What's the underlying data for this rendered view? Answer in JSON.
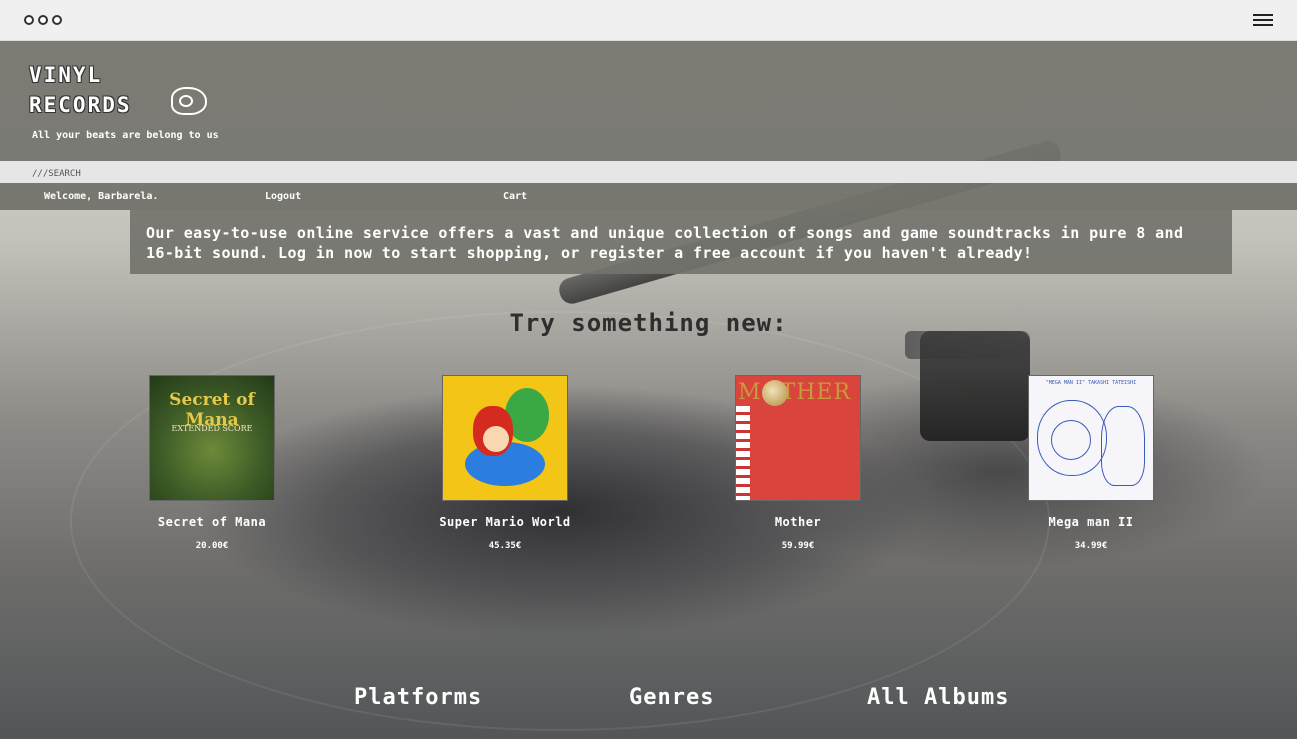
{
  "browser": {
    "menu_icon": "hamburger-icon",
    "window_controls_icon": "window-dots-icon"
  },
  "header": {
    "logo_line1": "VINYL",
    "logo_line2": "RECORDS",
    "logo_icon": "vinyl-logo-icon",
    "tagline": "All your beats are belong to us"
  },
  "search": {
    "placeholder": "///SEARCH"
  },
  "nav": {
    "welcome": "Welcome, Barbarela.",
    "logout": "Logout",
    "cart": "Cart"
  },
  "intro": {
    "text": "Our easy-to-use online service offers a vast and unique collection of songs and game soundtracks in pure 8 and 16-bit sound. Log in now to start shopping, or register a free account if you haven't already!"
  },
  "featured": {
    "title": "Try something new:",
    "products": [
      {
        "name": "Secret of Mana",
        "price": "20.00€",
        "cover_title": "Secret of Mana",
        "cover_subtitle": "EXTENDED SCORE"
      },
      {
        "name": "Super Mario World",
        "price": "45.35€"
      },
      {
        "name": "Mother",
        "price": "59.99€",
        "cover_title": "MOTHER"
      },
      {
        "name": "Mega man II",
        "price": "34.99€",
        "cover_title": "\"MEGA MAN II\" TAKASHI TATEISHI"
      }
    ]
  },
  "bottom_nav": {
    "platforms": "Platforms",
    "genres": "Genres",
    "all_albums": "All Albums"
  }
}
